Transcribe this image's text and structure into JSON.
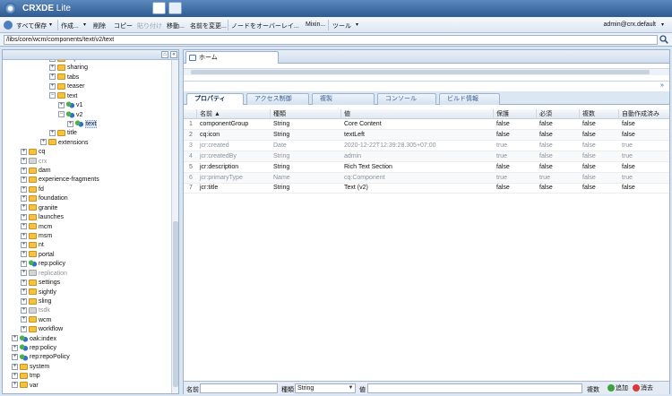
{
  "app": {
    "title": "CRXDE",
    "title_light": "Lite",
    "user": "admin@crx.default"
  },
  "toolbar": {
    "save_all": "すべて保存",
    "create": "作成...",
    "delete": "削除",
    "copy": "コピー",
    "paste": "貼り付け",
    "move": "移動...",
    "rename": "名前を変更...",
    "overlay": "ノードをオーバーレイ...",
    "mixin": "Mixin...",
    "tools": "ツール"
  },
  "path": "/libs/core/wcm/components/text/v2/text",
  "tree": [
    {
      "label": "separator",
      "depth": 4,
      "exp": "+",
      "icon": "folder",
      "grey": false
    },
    {
      "label": "sharing",
      "depth": 4,
      "exp": "+",
      "icon": "folder",
      "grey": false
    },
    {
      "label": "tabs",
      "depth": 4,
      "exp": "+",
      "icon": "folder",
      "grey": false
    },
    {
      "label": "teaser",
      "depth": 4,
      "exp": "+",
      "icon": "folder",
      "grey": false
    },
    {
      "label": "text",
      "depth": 4,
      "exp": "-",
      "icon": "folder",
      "grey": false
    },
    {
      "label": "v1",
      "depth": 5,
      "exp": "+",
      "icon": "node",
      "grey": false
    },
    {
      "label": "v2",
      "depth": 5,
      "exp": "-",
      "icon": "node",
      "grey": false
    },
    {
      "label": "text",
      "depth": 6,
      "exp": "+",
      "icon": "node",
      "grey": false,
      "sel": true
    },
    {
      "label": "title",
      "depth": 4,
      "exp": "+",
      "icon": "folder",
      "grey": false
    },
    {
      "label": "extensions",
      "depth": 3,
      "exp": "+",
      "icon": "folder",
      "grey": false
    },
    {
      "label": "cq",
      "depth": 1,
      "exp": "+",
      "icon": "folder",
      "grey": false
    },
    {
      "label": "crx",
      "depth": 1,
      "exp": "+",
      "icon": "folder",
      "grey": true
    },
    {
      "label": "dam",
      "depth": 1,
      "exp": "+",
      "icon": "folder",
      "grey": false
    },
    {
      "label": "experience-fragments",
      "depth": 1,
      "exp": "+",
      "icon": "folder",
      "grey": false
    },
    {
      "label": "fd",
      "depth": 1,
      "exp": "+",
      "icon": "folder",
      "grey": false
    },
    {
      "label": "foundation",
      "depth": 1,
      "exp": "+",
      "icon": "folder",
      "grey": false
    },
    {
      "label": "granite",
      "depth": 1,
      "exp": "+",
      "icon": "folder",
      "grey": false
    },
    {
      "label": "launches",
      "depth": 1,
      "exp": "+",
      "icon": "folder",
      "grey": false
    },
    {
      "label": "mcm",
      "depth": 1,
      "exp": "+",
      "icon": "folder",
      "grey": false
    },
    {
      "label": "msm",
      "depth": 1,
      "exp": "+",
      "icon": "folder",
      "grey": false
    },
    {
      "label": "nt",
      "depth": 1,
      "exp": "+",
      "icon": "folder",
      "grey": false
    },
    {
      "label": "portal",
      "depth": 1,
      "exp": "+",
      "icon": "folder",
      "grey": false
    },
    {
      "label": "rep:policy",
      "depth": 1,
      "exp": "+",
      "icon": "node",
      "grey": false
    },
    {
      "label": "replication",
      "depth": 1,
      "exp": "+",
      "icon": "folder",
      "grey": true
    },
    {
      "label": "settings",
      "depth": 1,
      "exp": "+",
      "icon": "folder",
      "grey": false
    },
    {
      "label": "sightly",
      "depth": 1,
      "exp": "+",
      "icon": "folder",
      "grey": false
    },
    {
      "label": "sling",
      "depth": 1,
      "exp": "+",
      "icon": "folder",
      "grey": false
    },
    {
      "label": "tsdk",
      "depth": 1,
      "exp": "+",
      "icon": "folder",
      "grey": true
    },
    {
      "label": "wcm",
      "depth": 1,
      "exp": "+",
      "icon": "folder",
      "grey": false
    },
    {
      "label": "workflow",
      "depth": 1,
      "exp": "+",
      "icon": "folder",
      "grey": false
    },
    {
      "label": "oak:index",
      "depth": 0,
      "exp": "+",
      "icon": "node",
      "grey": false
    },
    {
      "label": "rep:policy",
      "depth": 0,
      "exp": "+",
      "icon": "node",
      "grey": false
    },
    {
      "label": "rep:repoPolicy",
      "depth": 0,
      "exp": "+",
      "icon": "node",
      "grey": false
    },
    {
      "label": "system",
      "depth": 0,
      "exp": "+",
      "icon": "folder",
      "grey": false
    },
    {
      "label": "tmp",
      "depth": 0,
      "exp": "+",
      "icon": "folder",
      "grey": false
    },
    {
      "label": "var",
      "depth": 0,
      "exp": "+",
      "icon": "folder",
      "grey": false
    }
  ],
  "home_tab": "ホーム",
  "subtabs": [
    "プロパティ",
    "アクセス制御",
    "複製",
    "コンソール",
    "ビルド情報"
  ],
  "grid": {
    "headers": [
      "名前 ▲",
      "種類",
      "値",
      "保護",
      "必須",
      "複数",
      "自動作成済み"
    ],
    "rows": [
      {
        "n": "1",
        "name": "componentGroup",
        "type": "String",
        "value": "Core Content",
        "prot": "false",
        "mand": "false",
        "multi": "false",
        "auto": "false",
        "grey": false
      },
      {
        "n": "2",
        "name": "cq:icon",
        "type": "String",
        "value": "textLeft",
        "prot": "false",
        "mand": "false",
        "multi": "false",
        "auto": "false",
        "grey": false
      },
      {
        "n": "3",
        "name": "jcr:created",
        "type": "Date",
        "value": "2020-12-22T12:39:28.305+07:00",
        "prot": "true",
        "mand": "false",
        "multi": "false",
        "auto": "true",
        "grey": true
      },
      {
        "n": "4",
        "name": "jcr:createdBy",
        "type": "String",
        "value": "admin",
        "prot": "true",
        "mand": "false",
        "multi": "false",
        "auto": "true",
        "grey": true
      },
      {
        "n": "5",
        "name": "jcr:description",
        "type": "String",
        "value": "Rich Text Section",
        "prot": "false",
        "mand": "false",
        "multi": "false",
        "auto": "false",
        "grey": false
      },
      {
        "n": "6",
        "name": "jcr:primaryType",
        "type": "Name",
        "value": "cq:Component",
        "prot": "true",
        "mand": "true",
        "multi": "false",
        "auto": "true",
        "grey": true
      },
      {
        "n": "7",
        "name": "jcr:title",
        "type": "String",
        "value": "Text (v2)",
        "prot": "false",
        "mand": "false",
        "multi": "false",
        "auto": "false",
        "grey": false
      }
    ]
  },
  "footer": {
    "name_label": "名前",
    "type_label": "種類",
    "type_value": "String",
    "value_label": "値",
    "multi_label": "複数",
    "add": "追加",
    "remove": "消去"
  }
}
